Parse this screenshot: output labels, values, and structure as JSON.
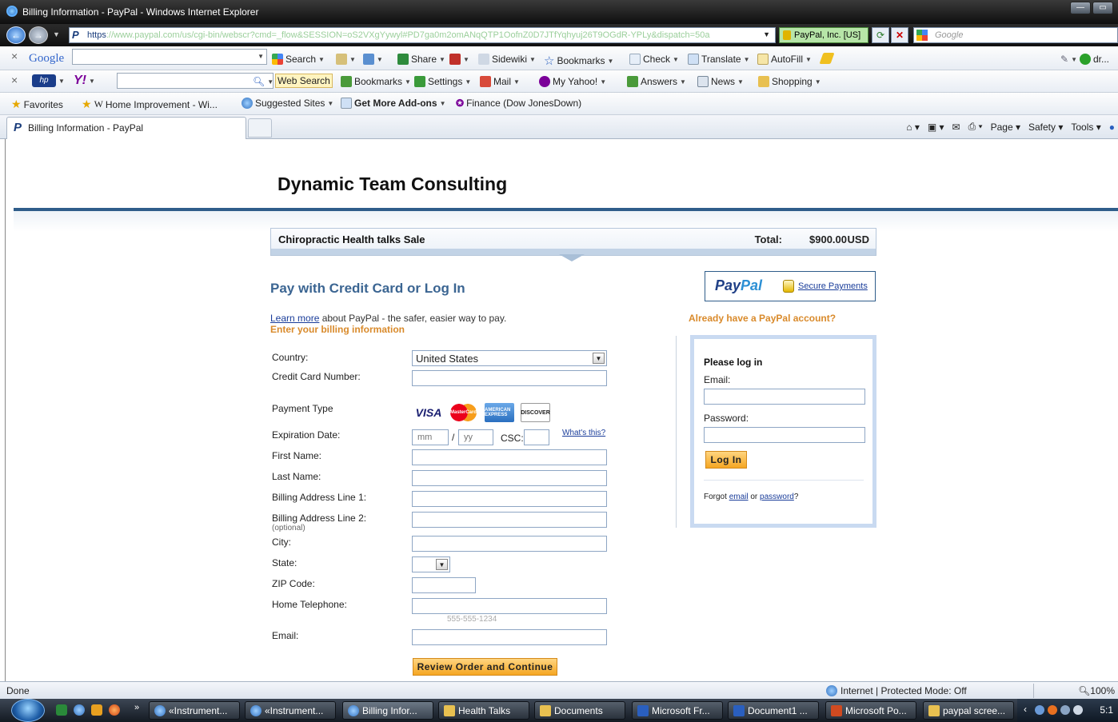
{
  "window": {
    "title": "Billing Information - PayPal - Windows Internet Explorer"
  },
  "address": {
    "scheme": "https",
    "host": "://www.paypal.com",
    "path": "/us/cgi-bin/webscr?cmd=_flow&SESSION=oS2VXgYywyl#PD7ga0m2omANqQTP1OofnZ0D7JTfYqhyuj26T9OGdR-YPLy&dispatch=50a",
    "cert": "PayPal, Inc. [US]",
    "search_placeholder": "Google"
  },
  "google_toolbar": {
    "brand": "Google",
    "items": [
      "Search",
      "Share",
      "Sidewiki",
      "Bookmarks",
      "Check",
      "Translate",
      "AutoFill"
    ],
    "right": "dr..."
  },
  "yahoo_toolbar": {
    "web_search": "Web Search",
    "items": [
      "Bookmarks",
      "Settings",
      "Mail",
      "My Yahoo!",
      "Answers",
      "News",
      "Shopping"
    ]
  },
  "favorites_bar": {
    "favorites": "Favorites",
    "items": [
      "Home Improvement - Wi...",
      "Suggested Sites",
      "Get More Add-ons",
      "Finance (Dow JonesDown)"
    ]
  },
  "tabs": {
    "active": "Billing Information - PayPal"
  },
  "command_bar": [
    "Page",
    "Safety",
    "Tools"
  ],
  "page": {
    "merchant": "Dynamic Team Consulting",
    "cart": {
      "item": "Chiropractic Health talks Sale",
      "total_label": "Total:",
      "total": "$900.00",
      "currency": "USD"
    },
    "heading": "Pay with Credit Card or Log In",
    "learn_link": "Learn more",
    "learn_text": " about PayPal - the safer, easier way to pay.",
    "billing_sub": "Enter your billing information",
    "form": {
      "country_label": "Country:",
      "country_value": "United States",
      "card_number_label": "Credit Card Number:",
      "payment_type_label": "Payment Type",
      "cards": [
        "VISA",
        "MasterCard",
        "AMERICAN EXPRESS",
        "DISCOVER"
      ],
      "expiration_label": "Expiration Date:",
      "mm_placeholder": "mm",
      "yy_placeholder": "yy",
      "slash": "/",
      "csc_label": "CSC:",
      "whats_this": "What's this?",
      "first_name_label": "First Name:",
      "last_name_label": "Last Name:",
      "address1_label": "Billing Address Line 1:",
      "address2_label": "Billing Address Line 2:",
      "optional": "(optional)",
      "city_label": "City:",
      "state_label": "State:",
      "zip_label": "ZIP Code:",
      "phone_label": "Home Telephone:",
      "phone_hint": "555-555-1234",
      "email_label": "Email:",
      "submit": "Review Order and Continue"
    },
    "paypal_badge": {
      "logo_pay": "Pay",
      "logo_pal": "Pal",
      "secure": "Secure Payments"
    },
    "already": "Already have a PayPal account?",
    "login": {
      "heading": "Please log in",
      "email_label": "Email:",
      "password_label": "Password:",
      "button": "Log In",
      "forgot_prefix": "Forgot ",
      "forgot_email": "email",
      "forgot_or": " or ",
      "forgot_password": "password",
      "forgot_suffix": "?"
    }
  },
  "status": {
    "text": "Done",
    "zone": "Internet | Protected Mode: Off",
    "zoom": "100%"
  },
  "taskbar": {
    "tasks": [
      "«Instrument...",
      "«Instrument...",
      "Billing Infor...",
      "Health Talks",
      "Documents",
      "Microsoft Fr...",
      "Document1 ...",
      "Microsoft Po...",
      "paypal scree..."
    ],
    "clock": "5:1"
  },
  "colors": {
    "paypal_blue": "#2f5d8a",
    "heading_blue": "#3b6592",
    "accent_orange": "#d98a2b",
    "button_orange": "#f5a623"
  }
}
